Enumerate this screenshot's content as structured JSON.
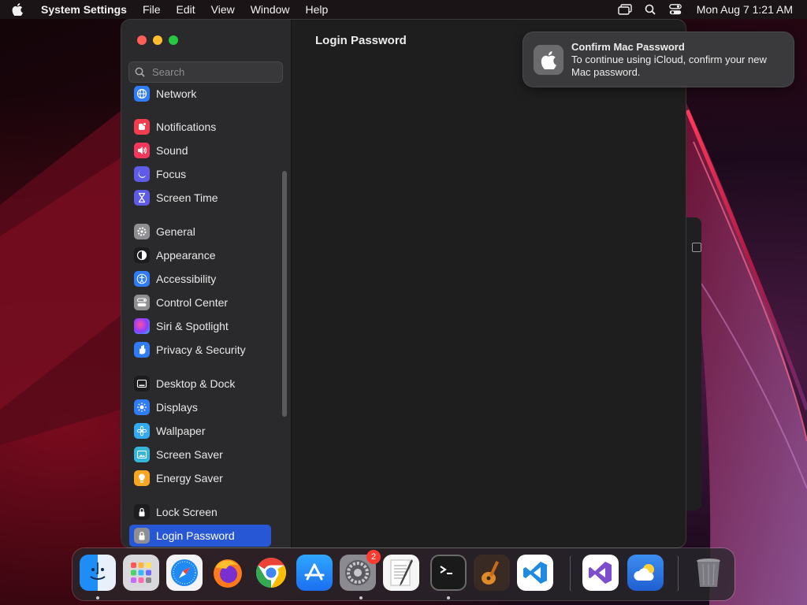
{
  "menubar": {
    "app_name": "System Settings",
    "menus": [
      "File",
      "Edit",
      "View",
      "Window",
      "Help"
    ],
    "clock": "Mon Aug 7  1:21 AM",
    "status_icons": [
      "screen-mirroring-icon",
      "spotlight-search-icon",
      "control-center-icon"
    ]
  },
  "sidebar": {
    "search_placeholder": "Search",
    "items": [
      {
        "label": "Network",
        "icon": "network-icon",
        "color": "#2f7cf6"
      },
      {
        "label": "Notifications",
        "icon": "notifications-icon",
        "color": "#f23d4e"
      },
      {
        "label": "Sound",
        "icon": "sound-icon",
        "color": "#f2385a"
      },
      {
        "label": "Focus",
        "icon": "focus-icon",
        "color": "#5e5ce6"
      },
      {
        "label": "Screen Time",
        "icon": "screen-time-icon",
        "color": "#5e5ce6"
      },
      {
        "label": "General",
        "icon": "general-icon",
        "color": "#8e8e93"
      },
      {
        "label": "Appearance",
        "icon": "appearance-icon",
        "color": "#1c1c1e"
      },
      {
        "label": "Accessibility",
        "icon": "accessibility-icon",
        "color": "#2f7cf6"
      },
      {
        "label": "Control Center",
        "icon": "control-center-icon",
        "color": "#8e8e93"
      },
      {
        "label": "Siri & Spotlight",
        "icon": "siri-icon",
        "color": "#b03dd1"
      },
      {
        "label": "Privacy & Security",
        "icon": "privacy-hand-icon",
        "color": "#2f7cf6"
      },
      {
        "label": "Desktop & Dock",
        "icon": "desktop-dock-icon",
        "color": "#1c1c1e"
      },
      {
        "label": "Displays",
        "icon": "displays-icon",
        "color": "#2f7cf6"
      },
      {
        "label": "Wallpaper",
        "icon": "wallpaper-icon",
        "color": "#35aaf0"
      },
      {
        "label": "Screen Saver",
        "icon": "screen-saver-icon",
        "color": "#35b6d8"
      },
      {
        "label": "Energy Saver",
        "icon": "energy-saver-icon",
        "color": "#f6a623"
      },
      {
        "label": "Lock Screen",
        "icon": "lock-screen-icon",
        "color": "#1c1c1e"
      },
      {
        "label": "Login Password",
        "icon": "login-password-icon",
        "color": "#8e8e93"
      }
    ],
    "selected_index": 17,
    "selected_color": "#2857d6"
  },
  "content": {
    "title": "Login Password"
  },
  "notification": {
    "title": "Confirm Mac Password",
    "body": "To continue using iCloud, confirm your new Mac password.",
    "icon": "apple-logo-icon"
  },
  "dock": {
    "apps": [
      {
        "name": "Finder",
        "icon": "finder-icon",
        "running": true
      },
      {
        "name": "Launchpad",
        "icon": "launchpad-icon",
        "running": false
      },
      {
        "name": "Safari",
        "icon": "safari-icon",
        "running": false
      },
      {
        "name": "Firefox",
        "icon": "firefox-icon",
        "running": false
      },
      {
        "name": "Google Chrome",
        "icon": "chrome-icon",
        "running": false
      },
      {
        "name": "App Store",
        "icon": "app-store-icon",
        "running": false
      },
      {
        "name": "System Settings",
        "icon": "system-settings-icon",
        "running": true,
        "badge": "2"
      },
      {
        "name": "TextEdit",
        "icon": "textedit-icon",
        "running": false
      },
      {
        "name": "Terminal",
        "icon": "terminal-icon",
        "running": true
      },
      {
        "name": "GarageBand",
        "icon": "garageband-icon",
        "running": false
      },
      {
        "name": "Visual Studio Code",
        "icon": "vscode-icon",
        "running": false
      },
      {
        "name": "Visual Studio",
        "icon": "visual-studio-icon",
        "running": false
      },
      {
        "name": "Weather",
        "icon": "weather-icon",
        "running": false
      },
      {
        "name": "Trash",
        "icon": "trash-icon",
        "running": false
      }
    ]
  }
}
